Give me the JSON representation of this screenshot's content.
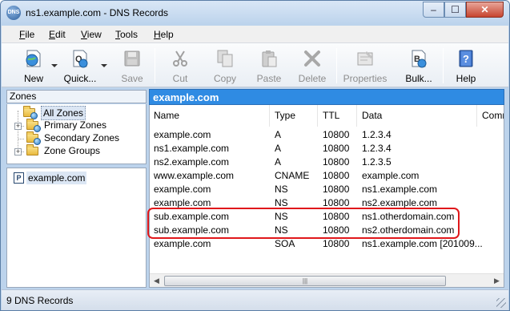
{
  "window": {
    "title": "ns1.example.com - DNS Records",
    "app_icon_text": "DNS",
    "minimize_glyph": "–",
    "maximize_glyph": "☐",
    "close_glyph": "✕"
  },
  "menu": [
    {
      "label": "File",
      "accel": "F",
      "rest": "ile"
    },
    {
      "label": "Edit",
      "accel": "E",
      "rest": "dit"
    },
    {
      "label": "View",
      "accel": "V",
      "rest": "iew"
    },
    {
      "label": "Tools",
      "accel": "T",
      "rest": "ools"
    },
    {
      "label": "Help",
      "accel": "H",
      "rest": "elp"
    }
  ],
  "toolbar": {
    "new": "New",
    "quick": "Quick...",
    "save": "Save",
    "cut": "Cut",
    "copy": "Copy",
    "paste": "Paste",
    "delete": "Delete",
    "properties": "Properties",
    "bulk": "Bulk...",
    "help": "Help"
  },
  "zones_pane": {
    "header": "Zones",
    "tree": [
      {
        "label": "All Zones",
        "selected": true
      },
      {
        "label": "Primary Zones"
      },
      {
        "label": "Secondary Zones"
      },
      {
        "label": "Zone Groups"
      }
    ]
  },
  "zone_list": {
    "items": [
      {
        "label": "example.com",
        "icon_text": "P"
      }
    ]
  },
  "records": {
    "zone_title": "example.com",
    "columns": [
      "Name",
      "Type",
      "TTL",
      "Data",
      "Comm"
    ],
    "rows": [
      {
        "name": "example.com",
        "type": "A",
        "ttl": "10800",
        "data": "1.2.3.4"
      },
      {
        "name": "ns1.example.com",
        "type": "A",
        "ttl": "10800",
        "data": "1.2.3.4"
      },
      {
        "name": "ns2.example.com",
        "type": "A",
        "ttl": "10800",
        "data": "1.2.3.5"
      },
      {
        "name": "www.example.com",
        "type": "CNAME",
        "ttl": "10800",
        "data": "example.com"
      },
      {
        "name": "example.com",
        "type": "NS",
        "ttl": "10800",
        "data": "ns1.example.com"
      },
      {
        "name": "example.com",
        "type": "NS",
        "ttl": "10800",
        "data": "ns2.example.com"
      },
      {
        "name": "sub.example.com",
        "type": "NS",
        "ttl": "10800",
        "data": "ns1.otherdomain.com"
      },
      {
        "name": "sub.example.com",
        "type": "NS",
        "ttl": "10800",
        "data": "ns2.otherdomain.com"
      },
      {
        "name": "example.com",
        "type": "SOA",
        "ttl": "10800",
        "data": "ns1.example.com [201009..."
      }
    ],
    "highlight_color": "#e0181b"
  },
  "statusbar": {
    "text": "9 DNS Records"
  },
  "scrollbar": {
    "left_arrow": "◀",
    "right_arrow": "▶",
    "thumb_grip": "|||"
  }
}
